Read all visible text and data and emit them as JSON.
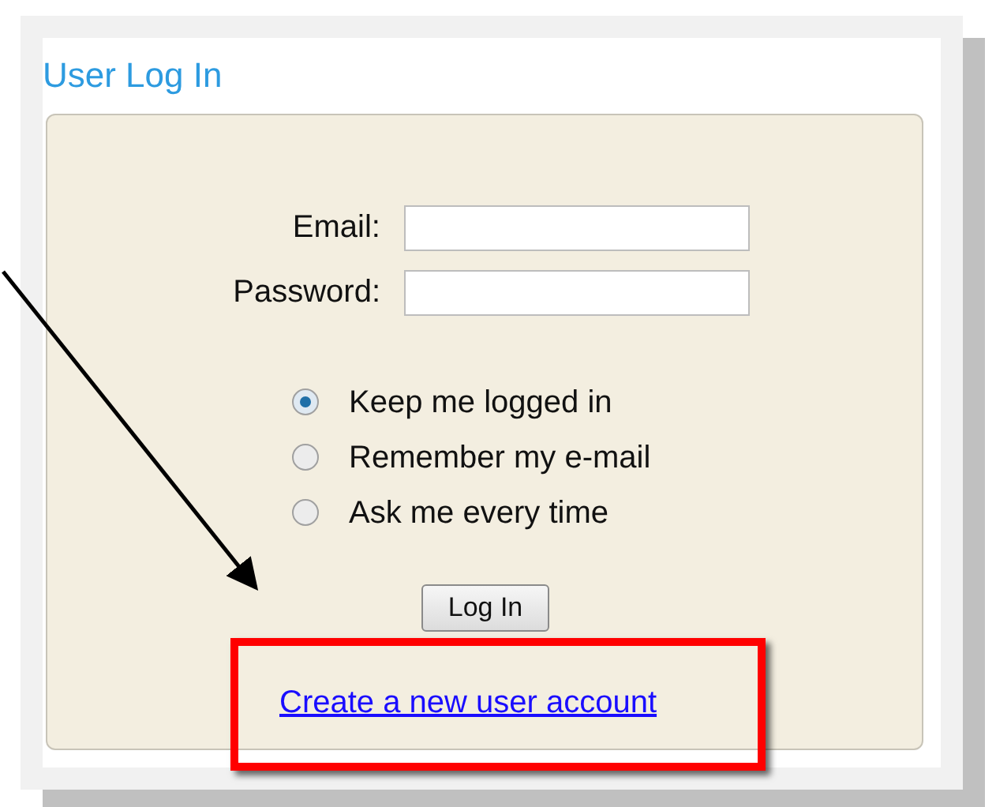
{
  "title": "User Log In",
  "fields": [
    {
      "label": "Email:"
    },
    {
      "label": "Password:"
    }
  ],
  "options": [
    {
      "label": "Keep me logged in",
      "selected": true
    },
    {
      "label": "Remember my e-mail",
      "selected": false
    },
    {
      "label": "Ask me every time",
      "selected": false
    }
  ],
  "button": "Log In",
  "link": "Create a new user account"
}
